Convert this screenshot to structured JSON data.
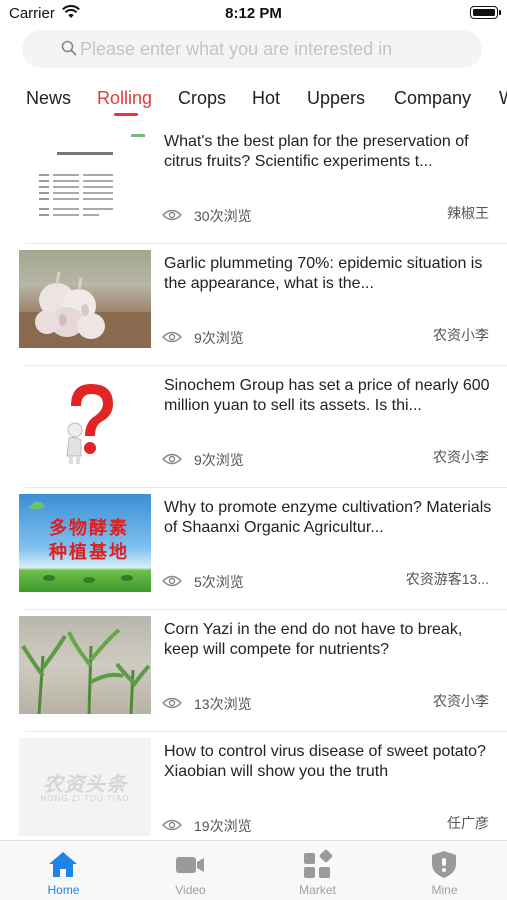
{
  "status_bar": {
    "carrier": "Carrier",
    "time": "8:12 PM"
  },
  "search": {
    "placeholder": "Please enter what you are interested in"
  },
  "tabs": [
    {
      "label": "News",
      "active": false
    },
    {
      "label": "Rolling",
      "active": true
    },
    {
      "label": "Crops",
      "active": false
    },
    {
      "label": "Hot",
      "active": false
    },
    {
      "label": "Uppers",
      "active": false
    },
    {
      "label": "Company",
      "active": false
    },
    {
      "label": "W",
      "active": false
    }
  ],
  "articles": [
    {
      "title": "What's the best plan for the preservation of citrus fruits? Scientific experiments t...",
      "views": "30次浏览",
      "author": "辣椒王",
      "thumb": "document-report-thumbnail"
    },
    {
      "title": "Garlic plummeting 70%: epidemic situation is the appearance, what is the...",
      "views": "9次浏览",
      "author": "农资小李",
      "thumb": "garlic-photo"
    },
    {
      "title": "Sinochem Group has set a price of nearly 600 million yuan to sell its assets. Is thi...",
      "views": "9次浏览",
      "author": "农资小李",
      "thumb": "question-mark-figure"
    },
    {
      "title": "Why to promote enzyme cultivation? Materials of Shaanxi Organic Agricultur...",
      "views": "5次浏览",
      "author": "农资游客13...",
      "thumb": "enzyme-base-banner",
      "thumb_text_1": "多物酵素",
      "thumb_text_2": "种植基地"
    },
    {
      "title": "Corn Yazi in the end do not have to break, keep will compete for nutrients?",
      "views": "13次浏览",
      "author": "农资小李",
      "thumb": "corn-seedlings-photo"
    },
    {
      "title": "How to control virus disease of sweet potato? Xiaobian will show you the truth",
      "views": "19次浏览",
      "author": "任广彦",
      "thumb": "brand-logo-placeholder",
      "thumb_text_1": "农资头条",
      "thumb_text_2": "NONG ZI TOU TIAO"
    }
  ],
  "tabbar": [
    {
      "label": "Home",
      "icon": "home-icon",
      "active": true
    },
    {
      "label": "Video",
      "icon": "video-camera-icon",
      "active": false
    },
    {
      "label": "Market",
      "icon": "grid-diamond-icon",
      "active": false
    },
    {
      "label": "Mine",
      "icon": "shield-icon",
      "active": false
    }
  ],
  "colors": {
    "accent": "#e53935",
    "tab_active": "#1f84e8",
    "tab_inactive": "#9e9e9e"
  }
}
